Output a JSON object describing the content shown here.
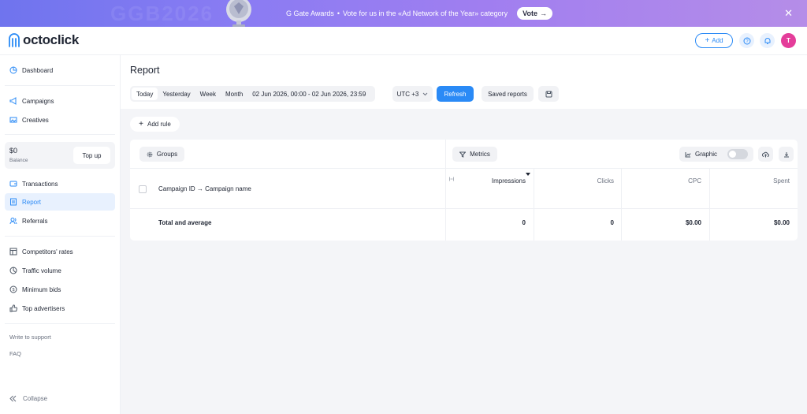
{
  "banner": {
    "bg_text": "GGB2026",
    "brand": "G Gate Awards",
    "bullet": "•",
    "message": "Vote for us in the «Ad Network of the Year» category",
    "vote_label": "Vote",
    "vote_arrow": "→",
    "close": "✕"
  },
  "header": {
    "logo_text": "octoclick",
    "add_label": "Add",
    "help_icon": "?",
    "avatar_letter": "T"
  },
  "sidebar": {
    "items": [
      {
        "label": "Dashboard",
        "icon": "pie-chart-icon"
      },
      {
        "label": "Campaigns",
        "icon": "megaphone-icon"
      },
      {
        "label": "Creatives",
        "icon": "image-icon"
      },
      {
        "label": "Transactions",
        "icon": "wallet-icon"
      },
      {
        "label": "Report",
        "icon": "report-icon",
        "active": true
      },
      {
        "label": "Referrals",
        "icon": "users-icon"
      },
      {
        "label": "Competitors' rates",
        "icon": "table-icon"
      },
      {
        "label": "Traffic volume",
        "icon": "pie-icon"
      },
      {
        "label": "Minimum bids",
        "icon": "dollar-circle-icon"
      },
      {
        "label": "Top advertisers",
        "icon": "thumbs-up-icon"
      }
    ],
    "balance": {
      "amount": "$0",
      "label": "Balance",
      "topup_label": "Top up"
    },
    "write_support": "Write to support",
    "faq": "FAQ",
    "collapse": "Collapse"
  },
  "report": {
    "title": "Report",
    "periods": [
      "Today",
      "Yesterday",
      "Week",
      "Month"
    ],
    "active_period": "Today",
    "date_range": "02 Jun 2026, 00:00 - 02 Jun 2026, 23:59",
    "timezone": "UTC +3",
    "refresh_label": "Refresh",
    "saved_reports_label": "Saved reports",
    "add_rule_label": "Add rule",
    "groups_label": "Groups",
    "metrics_label": "Metrics",
    "graphic_label": "Graphic",
    "graphic_enabled": false,
    "table": {
      "group_header": "Campaign ID → Campaign name",
      "columns": [
        "Impressions",
        "Clicks",
        "CPC",
        "Spent"
      ],
      "sorted_column": "Impressions",
      "total_label": "Total and average",
      "totals": [
        "0",
        "0",
        "$0.00",
        "$0.00"
      ]
    }
  },
  "colors": {
    "accent": "#2a8af6",
    "avatar": "#e43d9a",
    "banner_start": "#6f74ee",
    "banner_end": "#b58de8"
  }
}
